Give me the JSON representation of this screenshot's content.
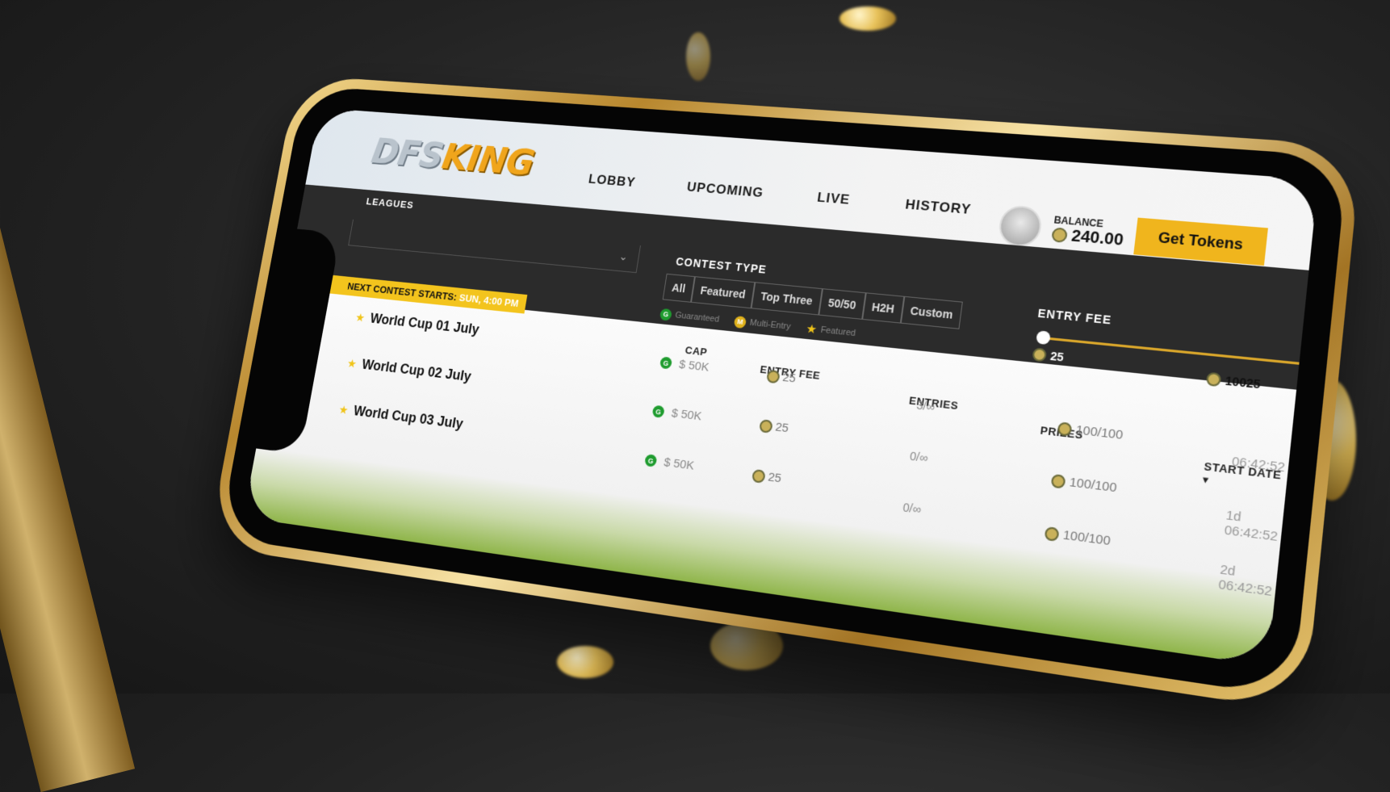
{
  "app": {
    "logo_part1": "DFS",
    "logo_part2": "KING"
  },
  "nav": {
    "items": [
      {
        "label": "LOBBY"
      },
      {
        "label": "UPCOMING"
      },
      {
        "label": "LIVE"
      },
      {
        "label": "HISTORY"
      }
    ]
  },
  "account": {
    "balance_label": "BALANCE",
    "balance_value": "240.00",
    "get_tokens_label": "Get Tokens"
  },
  "filters": {
    "leagues_label": "LEAGUES",
    "contest_type_label": "CONTEST TYPE",
    "contest_types": [
      "All",
      "Featured",
      "Top Three",
      "50/50",
      "H2H",
      "Custom"
    ],
    "legend": {
      "guaranteed": "Guaranteed",
      "multi_entry": "Multi-Entry",
      "featured": "Featured",
      "g_badge": "G",
      "m_badge": "M"
    },
    "entry_fee_label": "ENTRY FEE",
    "entry_fee_min": "25",
    "entry_fee_max": "10025"
  },
  "next_contest": {
    "label": "NEXT CONTEST STARTS:",
    "value": "SUN, 4:00 PM"
  },
  "table": {
    "headers": {
      "cap": "CAP",
      "entry_fee": "ENTRY FEE",
      "entries": "ENTRIES",
      "prizes": "PRIZES",
      "start_date": "START DATE ▾"
    },
    "rows": [
      {
        "name": "World Cup 01 July",
        "cap": "$ 50K",
        "fee": "25",
        "entries": "3/∞",
        "prizes": "100/100",
        "date": "06:42:52",
        "action": "✎"
      },
      {
        "name": "World Cup 02 July",
        "cap": "$ 50K",
        "fee": "25",
        "entries": "0/∞",
        "prizes": "100/100",
        "date": "1d 06:42:52",
        "action": "→"
      },
      {
        "name": "World Cup 03 July",
        "cap": "$ 50K",
        "fee": "25",
        "entries": "0/∞",
        "prizes": "100/100",
        "date": "2d 06:42:52",
        "action": "→"
      }
    ]
  },
  "colors": {
    "accent": "#f0b51d",
    "guaranteed": "#1f9c2f",
    "gold_frame": "#c9973a"
  }
}
